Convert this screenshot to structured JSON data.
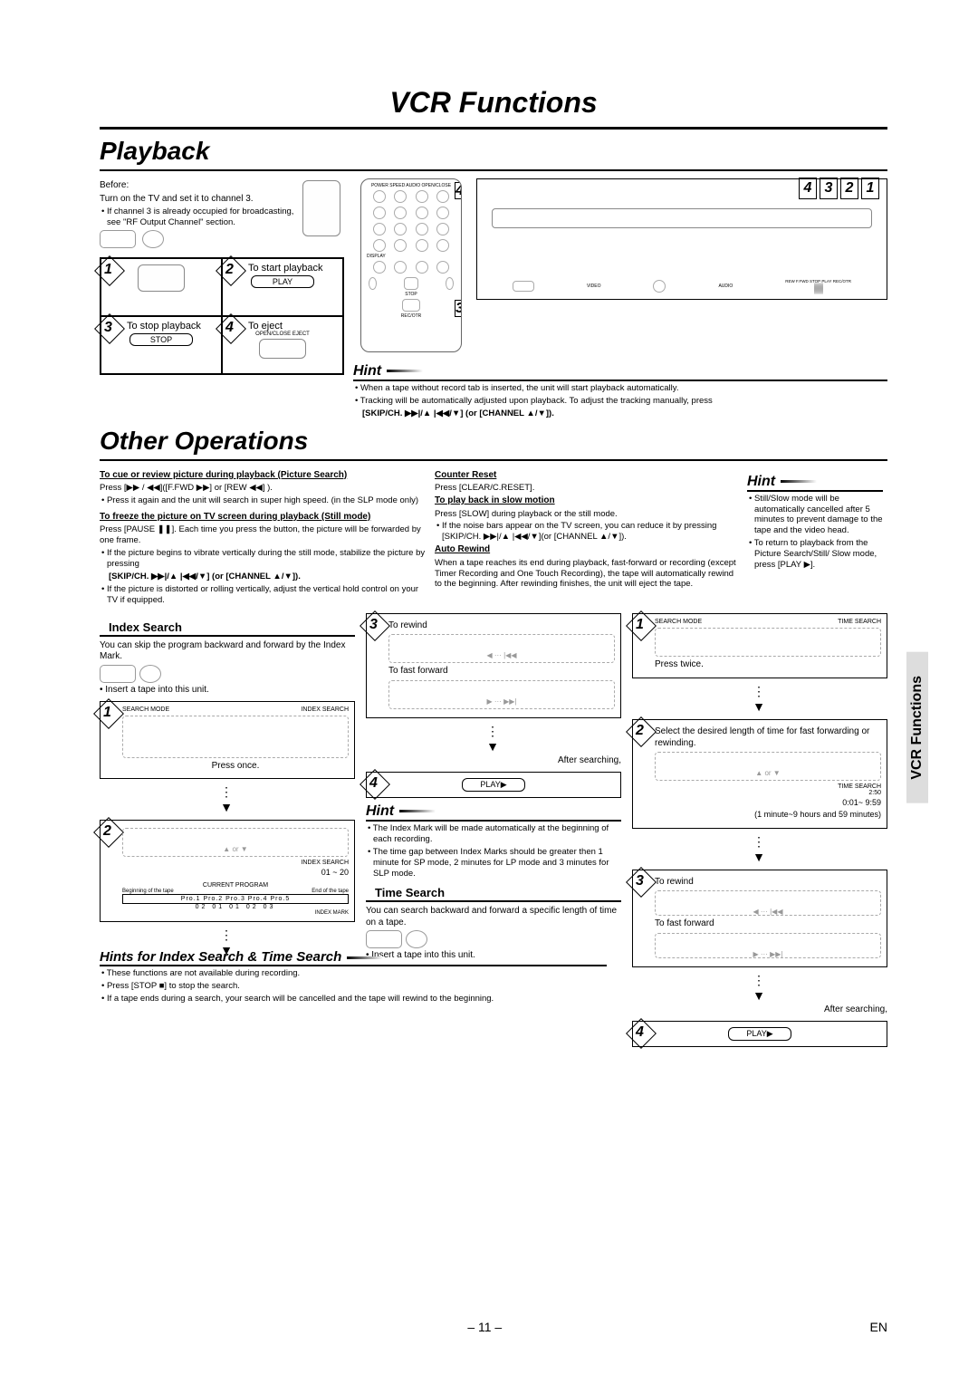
{
  "page_title": "VCR Functions",
  "section1": "Playback",
  "before": {
    "label": "Before:",
    "line": "Turn on the TV and set it to channel 3.",
    "note": "• If channel 3 is already occupied for broadcasting, see \"RF Output Channel\" section."
  },
  "steps": {
    "s2": "To start playback",
    "s3": "To stop playback",
    "s4": "To eject",
    "play": "PLAY",
    "stop": "STOP",
    "eject": "OPEN/CLOSE EJECT"
  },
  "hint1": {
    "title": "Hint",
    "a": "• When a tape without record tab is inserted, the unit will start playback automatically.",
    "b": "• Tracking will be automatically adjusted upon playback. To adjust the tracking manually, press",
    "c": "[SKIP/CH. ▶▶|/▲ |◀◀/▼] (or [CHANNEL ▲/▼])."
  },
  "section2": "Other Operations",
  "cue": {
    "h": "To cue or review picture during playback (Picture Search)",
    "l1": "Press [▶▶ / ◀◀]([F.FWD ▶▶] or [REW ◀◀] ).",
    "l2": "• Press it again and the unit will search in super high speed. (in the SLP mode only)"
  },
  "freeze": {
    "h": "To freeze the picture on TV screen during playback (Still mode)",
    "l1": "Press [PAUSE ❚❚]. Each time you press the button, the picture will be forwarded by one frame.",
    "l2": "• If the picture begins to vibrate vertically during the still mode, stabilize the picture by pressing",
    "l3": "[SKIP/CH. ▶▶|/▲ |◀◀/▼] (or [CHANNEL ▲/▼]).",
    "l4": "• If the picture is distorted or rolling vertically, adjust the vertical hold control on your TV if equipped."
  },
  "counter": {
    "h": "Counter Reset",
    "l": "Press [CLEAR/C.RESET]."
  },
  "slow": {
    "h": "To play back in slow motion",
    "l1": "Press [SLOW] during playback or the still mode.",
    "l2": "• If the noise bars appear on the TV screen, you can reduce it by pressing [SKIP/CH. ▶▶|/▲ |◀◀/▼](or [CHANNEL ▲/▼])."
  },
  "auto": {
    "h": "Auto Rewind",
    "l": "When a tape reaches its end during playback, fast-forward or recording (except Timer Recording and One Touch Recording), the tape will automatically rewind to the beginning. After rewinding finishes, the unit will eject the tape."
  },
  "hint2": {
    "title": "Hint",
    "a": "• Still/Slow mode will be automatically cancelled after 5 minutes to prevent damage to the tape and the video head.",
    "b": "• To return to playback from the Picture Search/Still/ Slow mode, press [PLAY ▶]."
  },
  "index": {
    "title": "Index Search",
    "l1": "You can skip the program backward and forward by the Index Mark.",
    "l2": "• Insert a tape into this unit.",
    "press_once": "Press once.",
    "label1": "INDEX SEARCH",
    "range": "01 ~ 20",
    "current": "CURRENT PROGRAM",
    "beg": "Beginning of the tape",
    "end": "End of the tape",
    "marks": "INDEX MARK",
    "row": "Pro.1  Pro.2  Pro.3  Pro.4  Pro.5",
    "nums": "02     01     01     02     03"
  },
  "idx_flow": {
    "rewind": "To rewind",
    "ff": "To fast forward",
    "after": "After searching,",
    "play": "PLAY▶"
  },
  "idx_hint": {
    "title": "Hint",
    "a": "• The Index Mark will be made automatically at the beginning of each recording.",
    "b": "• The time gap between Index Marks should be greater then 1 minute for SP mode, 2 minutes for LP mode and 3 minutes for SLP mode."
  },
  "time": {
    "title": "Time Search",
    "l1": "You can search backward and forward a specific length of time on a tape.",
    "l2": "• Insert a tape into this unit.",
    "step1": "SEARCH MODE",
    "label": "TIME SEARCH",
    "press_twice": "Press twice.",
    "step2": "Select the desired length of time for fast forwarding or rewinding.",
    "range": "0:01~ 9:59",
    "range_note": "(1 minute~9 hours and 59 minutes)",
    "search_val": "2:50",
    "rewind": "To rewind",
    "ff": "To fast forward",
    "after": "After searching,",
    "play": "PLAY▶"
  },
  "bottom_hints": {
    "title": "Hints for Index Search & Time Search",
    "a": "• These functions are not available during recording.",
    "b": "• Press [STOP ■] to stop the search.",
    "c": "• If a tape ends during a search, your search will be cancelled and the tape will rewind to the beginning."
  },
  "page_num": "– 11 –",
  "lang": "EN",
  "tab": "VCR Functions",
  "search_mode": "SEARCH MODE",
  "unit_labels": {
    "video": "VIDEO",
    "audio": "AUDIO",
    "buttons": "REW  F.FWD STOP PLAY  REC/OTR"
  },
  "remote_labels": {
    "top": "POWER  SPEED  AUDIO  OPEN/CLOSE",
    "bot": "DISPLAY",
    "reg": "REC/OTR",
    "stop": "STOP"
  }
}
